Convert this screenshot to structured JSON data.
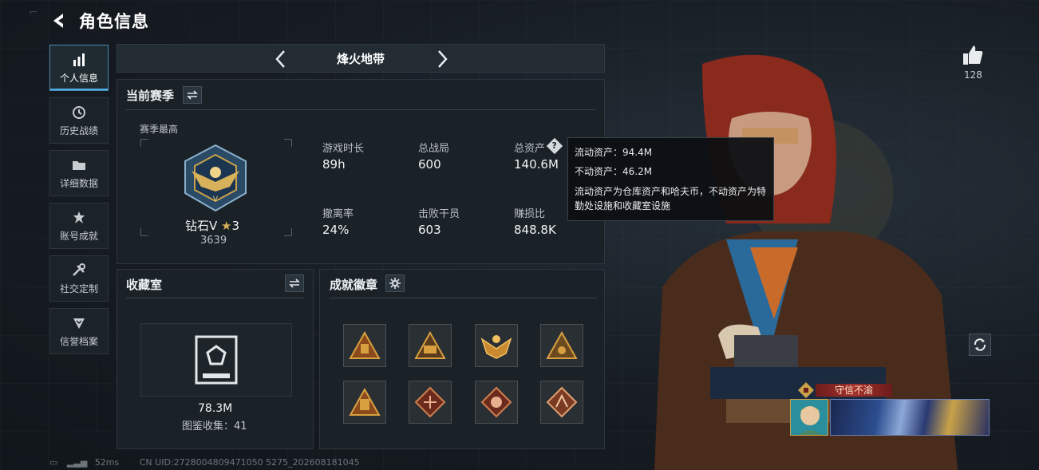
{
  "header": {
    "title": "角色信息"
  },
  "sidebar": {
    "items": [
      {
        "label": "个人信息",
        "icon": "bar-chart-icon",
        "active": true
      },
      {
        "label": "历史战绩",
        "icon": "clock-history-icon"
      },
      {
        "label": "详细数据",
        "icon": "folder-icon"
      },
      {
        "label": "账号成就",
        "icon": "achievement-star-icon"
      },
      {
        "label": "社交定制",
        "icon": "tools-icon"
      },
      {
        "label": "信誉档案",
        "icon": "shield-check-icon"
      }
    ]
  },
  "mode": {
    "name": "烽火地带"
  },
  "season": {
    "title": "当前赛季",
    "best_label": "赛季最高",
    "rank_name": "钻石V",
    "rank_stars": "3",
    "rank_score": "3639",
    "stats": [
      {
        "label": "游戏时长",
        "value": "89h"
      },
      {
        "label": "总战局",
        "value": "600"
      },
      {
        "label": "总资产",
        "value": "140.6M"
      },
      {
        "label": "撤离率",
        "value": "24%"
      },
      {
        "label": "击败干员",
        "value": "603"
      },
      {
        "label": "赚损比",
        "value": "848.8K"
      }
    ]
  },
  "tooltip": {
    "liquid": "流动资产：94.4M",
    "fixed": "不动资产：46.2M",
    "desc": "流动资产为仓库资产和哈夫币，不动资产为特勤处设施和收藏室设施"
  },
  "collection": {
    "title": "收藏室",
    "value": "78.3M",
    "catalog": "图鉴收集：41"
  },
  "badges": {
    "title": "成就徽章",
    "count": 8
  },
  "profile": {
    "likes": "128",
    "title_name": "守信不渝"
  },
  "footer": {
    "ping": "52ms",
    "uid": "CN UID:2728004809471050 5275_202608181045"
  },
  "colors": {
    "accent": "#4ab1e6",
    "gold": "#c9a24a",
    "panel": "#1a2127"
  }
}
